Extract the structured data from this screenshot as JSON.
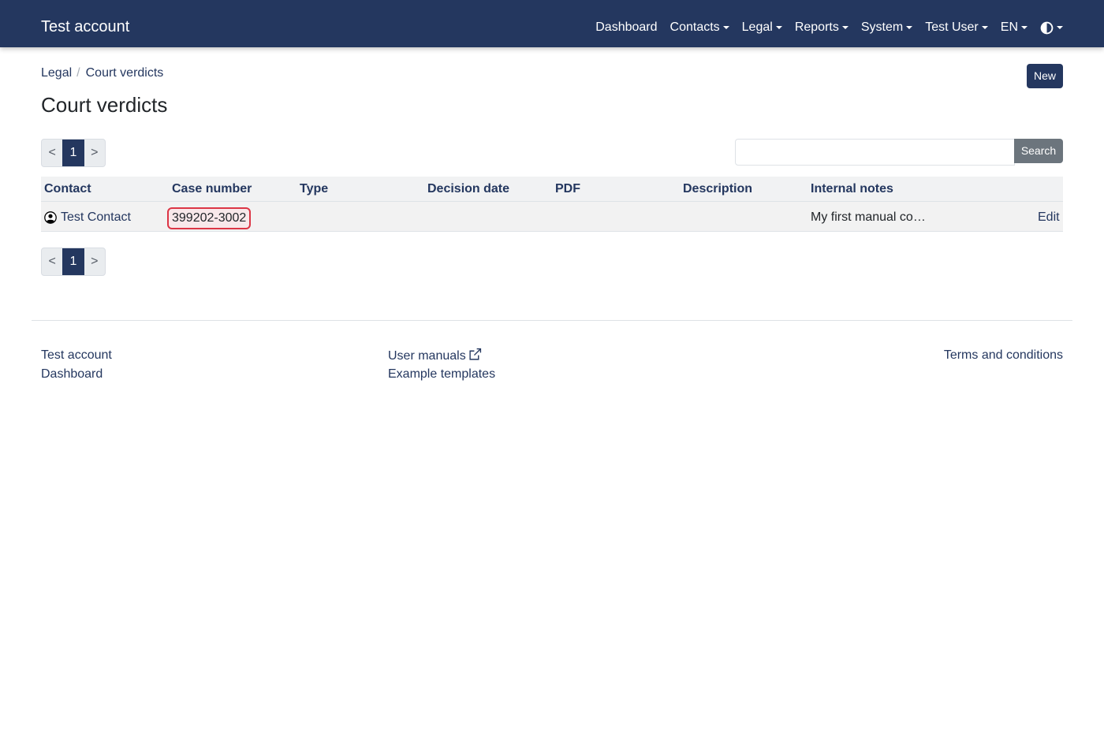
{
  "navbar": {
    "brand": "Test account",
    "items": [
      {
        "label": "Dashboard",
        "dropdown": false
      },
      {
        "label": "Contacts",
        "dropdown": true
      },
      {
        "label": "Legal",
        "dropdown": true
      },
      {
        "label": "Reports",
        "dropdown": true
      },
      {
        "label": "System",
        "dropdown": true
      },
      {
        "label": "Test User",
        "dropdown": true
      },
      {
        "label": "EN",
        "dropdown": true
      }
    ],
    "theme_icon": "contrast-half-circle-icon",
    "background": "#24375f"
  },
  "breadcrumb": [
    "Legal",
    "Court verdicts"
  ],
  "toolbar": {
    "new_label": "New",
    "search_label": "Search",
    "search_value": ""
  },
  "page_title": "Court verdicts",
  "pagination": {
    "prev": "<",
    "current": "1",
    "next": ">"
  },
  "table": {
    "columns": [
      "Contact",
      "Case number",
      "Type",
      "Decision date",
      "PDF",
      "Description",
      "Internal notes"
    ],
    "rows": [
      {
        "contact": "Test Contact",
        "contact_icon": "user-circle-icon",
        "case_number": "399202-3002",
        "type": "",
        "decision_date": "",
        "pdf": "",
        "description": "",
        "internal_notes": "My first manual co…",
        "action": "Edit"
      }
    ]
  },
  "footer": {
    "col1": [
      "Test account",
      "Dashboard"
    ],
    "col2": [
      "User manuals",
      "Example templates"
    ],
    "col3": [
      "Terms and conditions"
    ]
  },
  "colors": {
    "accent": "#24375f",
    "highlight_border": "#dc3545",
    "secondary": "#6c757d"
  }
}
